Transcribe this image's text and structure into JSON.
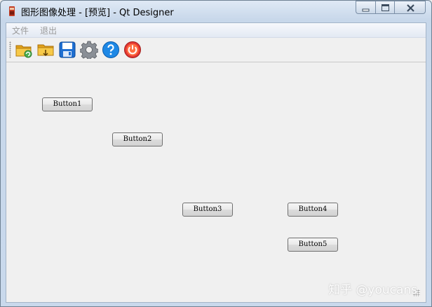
{
  "window": {
    "title": "图形图像处理 - [预览] - Qt Designer"
  },
  "menubar": {
    "items": [
      "文件",
      "退出"
    ]
  },
  "toolbar": {
    "tools": [
      "open-folder-icon",
      "folder-export-icon",
      "save-icon",
      "settings-gear-icon",
      "help-icon",
      "power-exit-icon"
    ]
  },
  "buttons": {
    "button1": "Button1",
    "button2": "Button2",
    "button3": "Button3",
    "button4": "Button4",
    "button5": "Button5"
  },
  "watermark": "知乎 @youcans",
  "colors": {
    "titlebar": "#c9d9ec",
    "client_bg": "#f0f0f0",
    "menu_text_disabled": "#9a9a9a"
  }
}
